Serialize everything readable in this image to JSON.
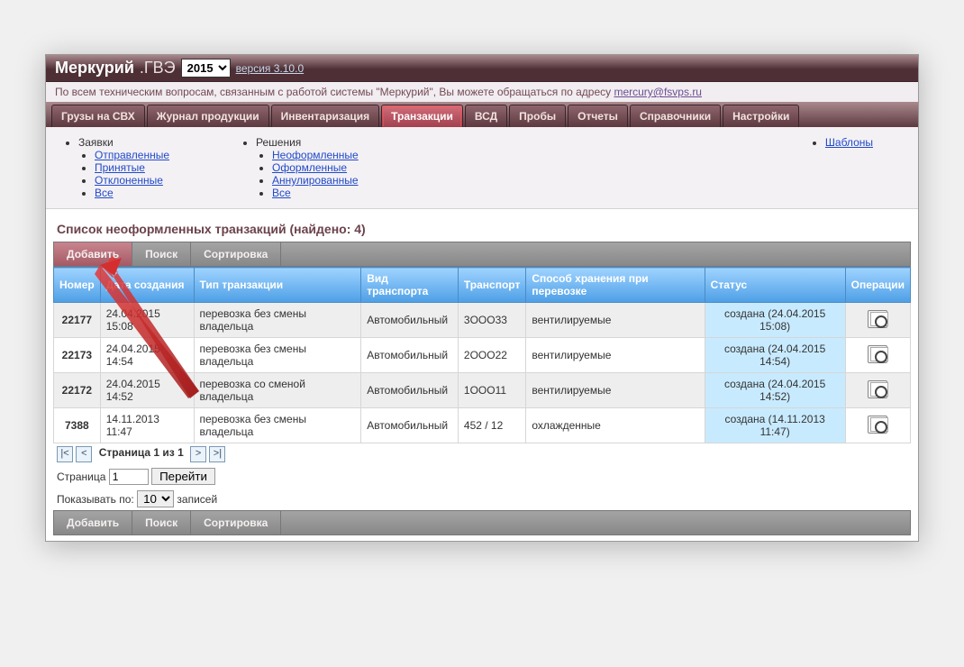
{
  "header": {
    "app_name": "Меркурий",
    "app_suffix": ".ГВЭ",
    "year": "2015",
    "version_label": "версия 3.10.0",
    "info_text": "По всем техническим вопросам, связанным с работой системы \"Меркурий\", Вы можете обращаться по адресу ",
    "info_email": "mercury@fsvps.ru"
  },
  "tabs": [
    {
      "label": "Грузы на СВХ",
      "active": false
    },
    {
      "label": "Журнал продукции",
      "active": false
    },
    {
      "label": "Инвентаризация",
      "active": false
    },
    {
      "label": "Транзакции",
      "active": true
    },
    {
      "label": "ВСД",
      "active": false
    },
    {
      "label": "Пробы",
      "active": false
    },
    {
      "label": "Отчеты",
      "active": false
    },
    {
      "label": "Справочники",
      "active": false
    },
    {
      "label": "Настройки",
      "active": false
    }
  ],
  "subnav": {
    "col1_title": "Заявки",
    "col1": [
      "Отправленные",
      "Принятые",
      "Отклоненные",
      "Все"
    ],
    "col2_title": "Решения",
    "col2": [
      "Неоформленные",
      "Оформленные",
      "Аннулированные",
      "Все"
    ],
    "col3": [
      "Шаблоны"
    ]
  },
  "page_title": "Список неоформленных транзакций (найдено: 4)",
  "toolbar": {
    "add": "Добавить",
    "search": "Поиск",
    "sort": "Сортировка"
  },
  "table": {
    "headers": [
      "Номер",
      "Дата создания",
      "Тип транзакции",
      "Вид транспорта",
      "Транспорт",
      "Способ хранения при перевозке",
      "Статус",
      "Операции"
    ],
    "rows": [
      {
        "num": "22177",
        "date": "24.04.2015 15:08",
        "type": "перевозка без смены владельца",
        "transport_kind": "Автомобильный",
        "transport": "3ООО33",
        "storage": "вентилируемые",
        "status": "создана (24.04.2015 15:08)"
      },
      {
        "num": "22173",
        "date": "24.04.2015 14:54",
        "type": "перевозка без смены владельца",
        "transport_kind": "Автомобильный",
        "transport": "2ООО22",
        "storage": "вентилируемые",
        "status": "создана (24.04.2015 14:54)"
      },
      {
        "num": "22172",
        "date": "24.04.2015 14:52",
        "type": "перевозка со сменой владельца",
        "transport_kind": "Автомобильный",
        "transport": "1ООО11",
        "storage": "вентилируемые",
        "status": "создана (24.04.2015 14:52)"
      },
      {
        "num": "7388",
        "date": "14.11.2013 11:47",
        "type": "перевозка без смены владельца",
        "transport_kind": "Автомобильный",
        "transport": "452 / 12",
        "storage": "охлажденные",
        "status": "создана (14.11.2013 11:47)"
      }
    ]
  },
  "pager": {
    "first": "|<",
    "prev": "<",
    "page_text": "Страница 1 из 1",
    "next": ">",
    "last": ">|",
    "page_label": "Страница",
    "page_value": "1",
    "go": "Перейти",
    "show_label": "Показывать по:",
    "show_value": "10",
    "records_label": "записей"
  }
}
